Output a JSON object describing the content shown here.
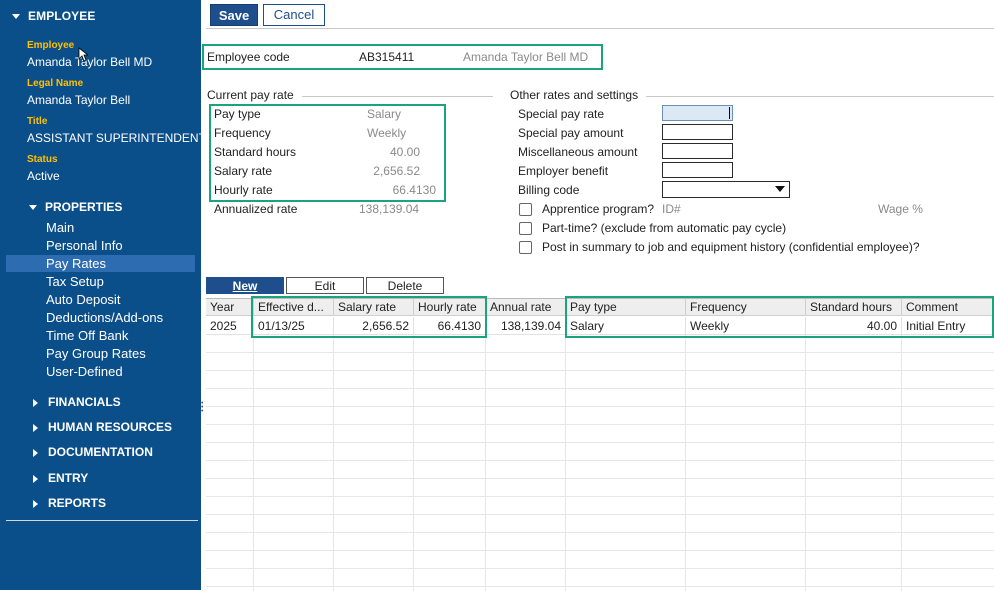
{
  "sidebar": {
    "header": "EMPLOYEE",
    "employee_label": "Employee",
    "employee_value": "Amanda Taylor Bell MD",
    "legal_label": "Legal Name",
    "legal_value": "Amanda Taylor Bell",
    "title_label": "Title",
    "title_value": "ASSISTANT SUPERINTENDENT",
    "status_label": "Status",
    "status_value": "Active",
    "properties_label": "PROPERTIES",
    "items": [
      "Main",
      "Personal Info",
      "Pay Rates",
      "Tax Setup",
      "Auto Deposit",
      "Deductions/Add-ons",
      "Time Off Bank",
      "Pay Group Rates",
      "User-Defined"
    ],
    "active_item": "Pay Rates",
    "sections": [
      "FINANCIALS",
      "HUMAN RESOURCES",
      "DOCUMENTATION",
      "ENTRY",
      "REPORTS"
    ]
  },
  "toolbar": {
    "save_label": "Save",
    "cancel_label": "Cancel"
  },
  "employee_code": {
    "label": "Employee code",
    "code": "AB315411",
    "name": "Amanda Taylor Bell MD"
  },
  "current_pay_rate": {
    "legend": "Current pay rate",
    "rows": [
      {
        "label": "Pay type",
        "value": "Salary"
      },
      {
        "label": "Frequency",
        "value": "Weekly"
      },
      {
        "label": "Standard hours",
        "value": "40.00"
      },
      {
        "label": "Salary rate",
        "value": "2,656.52"
      },
      {
        "label": "Hourly rate",
        "value": "66.4130"
      },
      {
        "label": "Annualized rate",
        "value": "138,139.04"
      }
    ]
  },
  "other_rates": {
    "legend": "Other rates and settings",
    "special_pay_rate": "Special pay rate",
    "special_pay_amount": "Special pay amount",
    "misc_amount": "Miscellaneous amount",
    "employer_benefit": "Employer benefit",
    "billing_code": "Billing code",
    "apprentice": "Apprentice program?",
    "id_label": "ID#",
    "wage_label": "Wage %",
    "part_time": "Part-time? (exclude from automatic pay cycle)",
    "post_summary": "Post in summary to job and equipment history (confidential employee)?"
  },
  "grid_buttons": {
    "new": "New",
    "edit": "Edit",
    "delete": "Delete"
  },
  "grid": {
    "columns": [
      "Year",
      "Effective d...",
      "Salary rate",
      "Hourly rate",
      "Annual rate",
      "Pay type",
      "Frequency",
      "Standard hours",
      "Comment"
    ],
    "rows": [
      [
        "2025",
        "01/13/25",
        "2,656.52",
        "66.4130",
        "138,139.04",
        "Salary",
        "Weekly",
        "40.00",
        "Initial Entry"
      ]
    ]
  },
  "colors": {
    "sidebar": "#0b4f8a",
    "accent": "#1f4e8c",
    "highlight": "#1ba37e",
    "label": "#ffc000"
  }
}
